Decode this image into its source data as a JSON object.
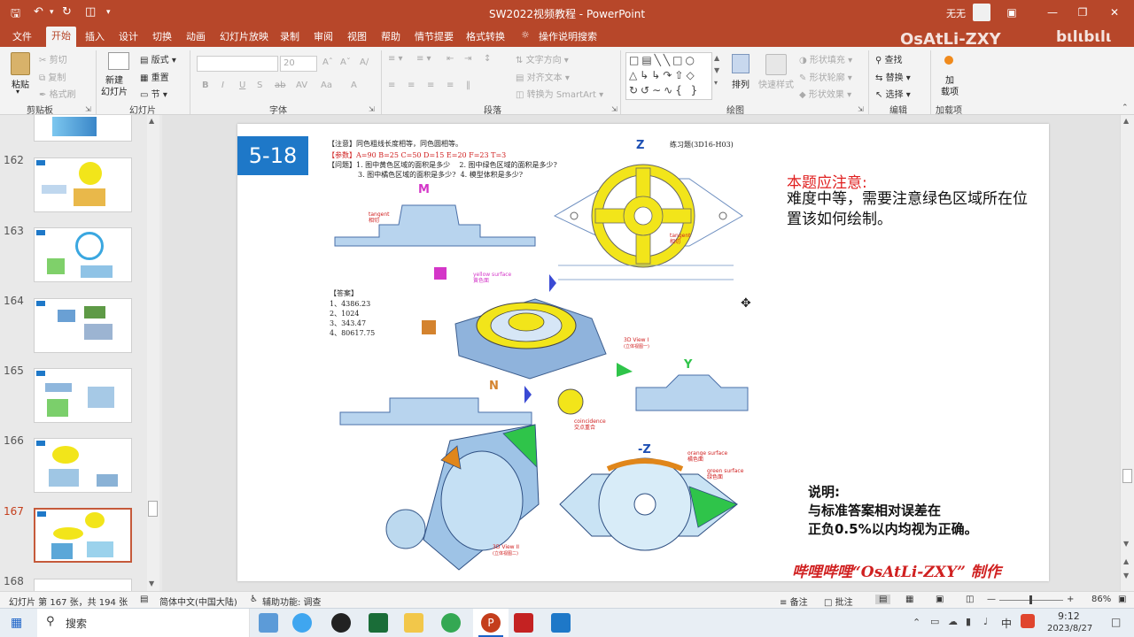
{
  "window": {
    "title": "SW2022视频教程  -  PowerPoint",
    "user": "无无",
    "watermark": "OsAtLi-ZXY"
  },
  "tabs": [
    "文件",
    "开始",
    "插入",
    "设计",
    "切换",
    "动画",
    "幻灯片放映",
    "录制",
    "审阅",
    "视图",
    "帮助",
    "情节提要",
    "格式转换"
  ],
  "tell_me": "操作说明搜索",
  "ribbon": {
    "clipboard": {
      "paste": "粘贴",
      "cut": "剪切",
      "copy": "复制",
      "format_painter": "格式刷",
      "label": "剪贴板"
    },
    "slides": {
      "new_slide": "新建\n幻灯片",
      "layout": "版式",
      "reset": "重置",
      "section": "节",
      "label": "幻灯片"
    },
    "font": {
      "size": "20",
      "label": "字体"
    },
    "paragraph": {
      "text_direction": "文字方向",
      "align_text": "对齐文本",
      "smartart": "转换为 SmartArt",
      "label": "段落"
    },
    "drawing": {
      "arrange": "排列",
      "quick_styles": "快速样式",
      "shape_fill": "形状填充",
      "shape_outline": "形状轮廓",
      "shape_effects": "形状效果",
      "label": "绘图"
    },
    "editing": {
      "find": "查找",
      "replace": "替换",
      "select": "选择",
      "label": "编辑"
    },
    "addins": {
      "addins": "加\n载项",
      "label": "加载项"
    }
  },
  "thumbnails": [
    {
      "num": "162"
    },
    {
      "num": "163"
    },
    {
      "num": "164"
    },
    {
      "num": "165"
    },
    {
      "num": "166"
    },
    {
      "num": "167",
      "active": true
    },
    {
      "num": "168"
    }
  ],
  "slide": {
    "badge": "5-18",
    "notes_tag": "【注意】",
    "notes_text": "同色粗线长度相等，同色圆相等。",
    "params_tag": "【参数】",
    "params_text": "A=90   B=25   C=50   D=15   E=20   F=23   T=3",
    "questions_tag": "【问题】",
    "q1": "1. 图中黄色区域的面积是多少",
    "q2": "2. 图中绿色区域的面积是多少?",
    "q3": "3. 图中橘色区域的面积是多少?",
    "q4": "4. 模型体积是多少?",
    "exercise": "练习题(3D16-H03)",
    "answers_tag": "【答案】",
    "answers": [
      "1、4386.23",
      "2、1024",
      "3、343.47",
      "4、80617.75"
    ],
    "view_labels": {
      "z": "Z",
      "m": "M",
      "n": "N",
      "y": "Y",
      "neg_z": "-Z"
    },
    "annotations": {
      "tangent": "tangent",
      "tangent_cn": "相切",
      "yellow_surface": "yellow surface",
      "yellow_surface_cn": "黄色面",
      "view1": "3D View I",
      "view1_cn": "(立体视图一)",
      "coincidence": "coincidence",
      "coincidence_cn": "交点重合",
      "view2": "3D View II",
      "view2_cn": "(立体视图二)",
      "orange_surface": "orange surface",
      "orange_surface_cn": "橘色面",
      "green_surface": "green surface",
      "green_surface_cn": "绿色面"
    },
    "note_title": "本题应注意:",
    "note_body": "难度中等，需要注意绿色区域所在位置该如何绘制。",
    "explain_title": "说明:",
    "explain_body1": "与标准答案相对误差在",
    "explain_body2": "正负0.5%以内均视为正确。",
    "signature": "哔哩哔哩“OsAtLi-ZXY” 制作"
  },
  "status": {
    "slide_info": "幻灯片 第 167 张，共 194 张",
    "language": "简体中文(中国大陆)",
    "accessibility": "辅助功能: 调查",
    "notes": "备注",
    "comments": "批注",
    "zoom": "86%"
  },
  "taskbar": {
    "search": "搜索",
    "time": "9:12",
    "date": "2023/8/27",
    "ime": "中"
  },
  "colors": {
    "accent": "#b7472a",
    "badge": "#1e78c8",
    "yellow": "#f2e51a",
    "green": "#2fc44a",
    "orange": "#e0861a",
    "red_text": "#e02020"
  }
}
